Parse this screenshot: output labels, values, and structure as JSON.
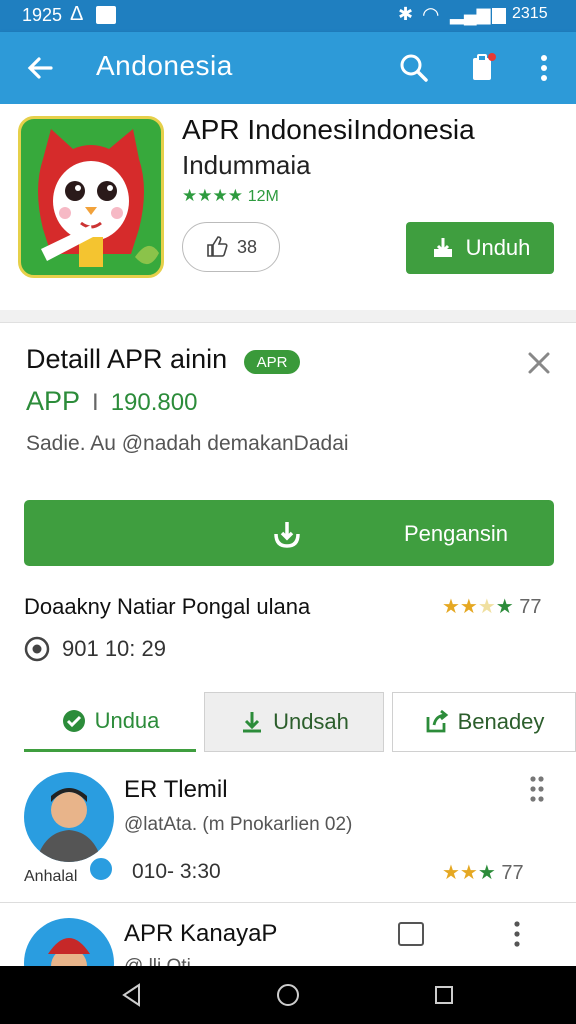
{
  "status": {
    "time": "1925",
    "battery": "2315"
  },
  "appbar": {
    "title": "Andonesia"
  },
  "app": {
    "name": "APR IndonesiIndonesia",
    "subtitle": "Indummaia",
    "stars": "★★★★",
    "rating_count": "12M",
    "likes": "38",
    "install_label": "Unduh"
  },
  "detail": {
    "title": "Detaill APR ainin",
    "badge": "APR",
    "price_label": "APP",
    "price_sep": "I",
    "price_value": "190.800",
    "description": "Sadie.  Au @nadah demakanDadai",
    "action_label": "Pengansin",
    "info_text": "Doaakny Natiar Pongal ulana",
    "info_rating_value": "77",
    "time": "901 10: 29"
  },
  "tabs": [
    {
      "label": "Undua"
    },
    {
      "label": "Undsah"
    },
    {
      "label": "Benadey"
    }
  ],
  "items": [
    {
      "title": "ER Tlemil",
      "sub": "@latAta. (m Pnokarlien 02)",
      "caption": "Anhalal",
      "time": "010- 3:30",
      "rating_value": "77"
    },
    {
      "title": "APR KanayaP",
      "sub": "@ lli Oti"
    }
  ],
  "colors": {
    "primary": "#2d9ad8",
    "status": "#1f7fc0",
    "accent": "#3f9e3f",
    "star_gold": "#e5a823"
  }
}
